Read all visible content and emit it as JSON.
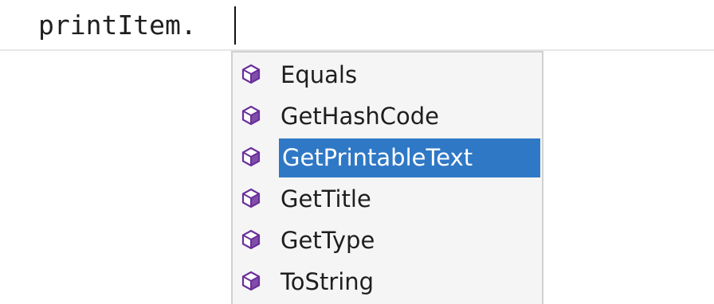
{
  "editor": {
    "code_text": "printItem."
  },
  "completion": {
    "items": [
      {
        "label": "Equals",
        "icon": "method-cube-icon",
        "selected": false
      },
      {
        "label": "GetHashCode",
        "icon": "method-cube-icon",
        "selected": false
      },
      {
        "label": "GetPrintableText",
        "icon": "method-cube-icon",
        "selected": true
      },
      {
        "label": "GetTitle",
        "icon": "method-cube-icon",
        "selected": false
      },
      {
        "label": "GetType",
        "icon": "method-cube-icon",
        "selected": false
      },
      {
        "label": "ToString",
        "icon": "method-cube-icon",
        "selected": false
      }
    ]
  },
  "colors": {
    "selection_background": "#2f78c5",
    "icon_purple": "#6a2f9a",
    "popup_background": "#f5f5f5"
  }
}
